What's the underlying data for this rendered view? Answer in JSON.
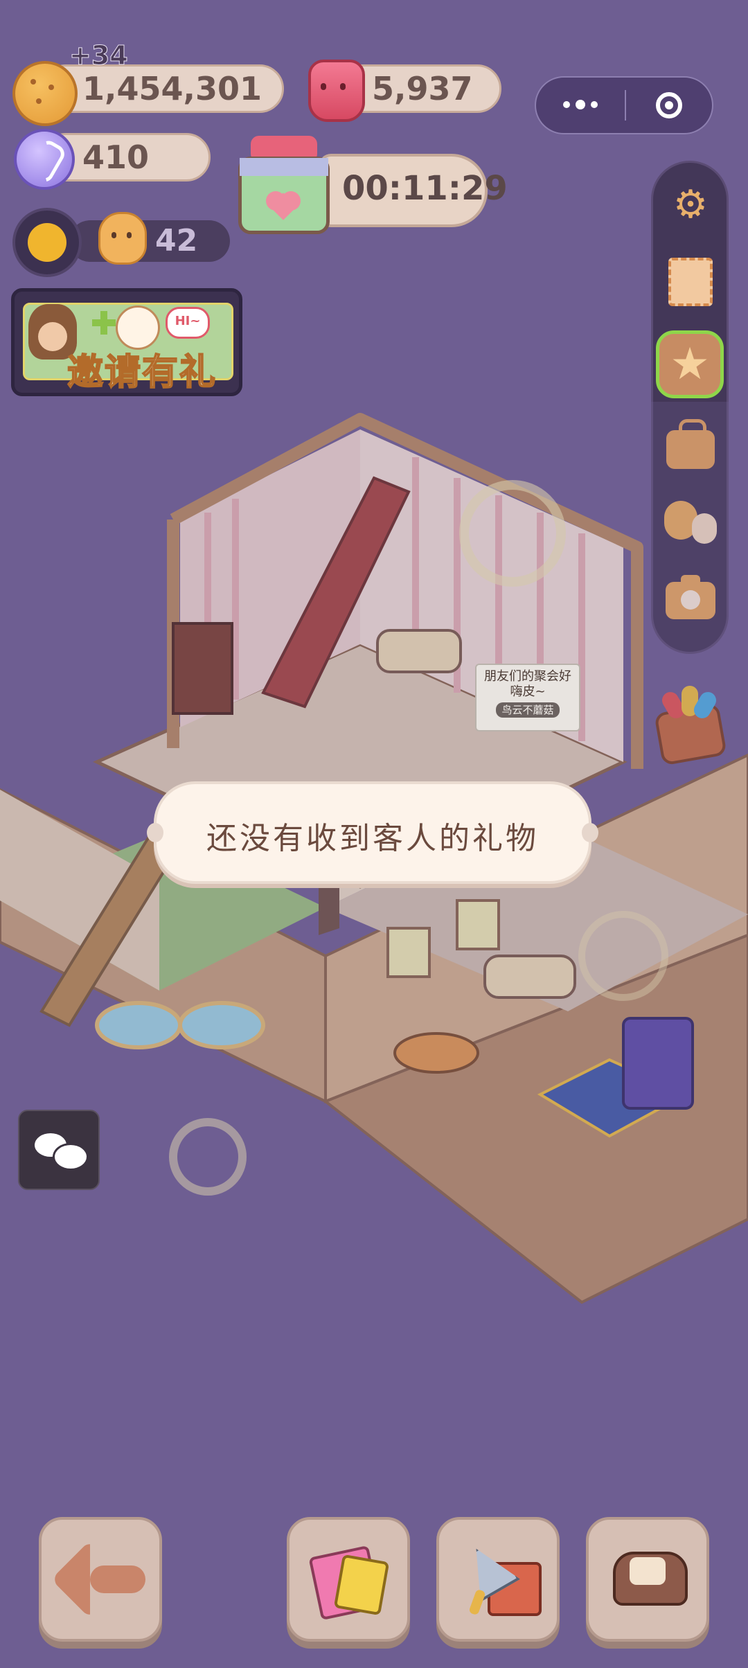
{
  "hud": {
    "gold_delta": "+34",
    "gold_amount": "1,454,301",
    "gems_amount": "5,937",
    "candy_amount": "410",
    "bonus_count": "42",
    "gift_timer": "00:11:29"
  },
  "invite_banner": {
    "label": "邀请有礼",
    "bubble_text": "HI~"
  },
  "room": {
    "speech_bubble_line1": "朋友们的聚会好",
    "speech_bubble_line2": "嗨皮~",
    "speech_bubble_author": "鸟云不蘑菇"
  },
  "toast": {
    "message": "还没有收到客人的礼物"
  },
  "toolbar": {
    "items": [
      "settings",
      "stamp",
      "star-collection",
      "bag",
      "friends",
      "camera"
    ]
  },
  "colors": {
    "background": "#6e5e92",
    "toast_bg": "#fdf3ea",
    "toast_text": "#6b4a3e",
    "pill_bg": "#e6d3c8",
    "active_tool_outline": "#8fd64a"
  }
}
